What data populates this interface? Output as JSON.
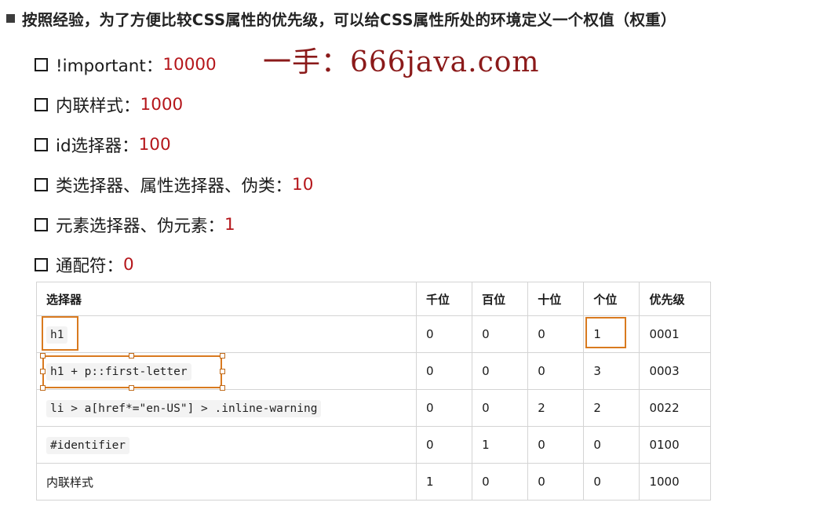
{
  "header": {
    "text": "按照经验，为了方便比较CSS属性的优先级，可以给CSS属性所处的环境定义一个权值（权重）"
  },
  "watermark": "一手：666java.com",
  "rules": [
    {
      "label": "!important：",
      "value": "10000"
    },
    {
      "label": "内联样式：",
      "value": "1000"
    },
    {
      "label": "id选择器：",
      "value": "100"
    },
    {
      "label": "类选择器、属性选择器、伪类：",
      "value": "10"
    },
    {
      "label": "元素选择器、伪元素：",
      "value": "1"
    },
    {
      "label": "通配符：",
      "value": "0"
    }
  ],
  "table": {
    "headers": [
      "选择器",
      "千位",
      "百位",
      "十位",
      "个位",
      "优先级"
    ],
    "rows": [
      {
        "selector": "h1",
        "code": true,
        "thousands": "0",
        "hundreds": "0",
        "tens": "0",
        "ones": "1",
        "specificity": "0001"
      },
      {
        "selector": "h1 + p::first-letter",
        "code": true,
        "thousands": "0",
        "hundreds": "0",
        "tens": "0",
        "ones": "3",
        "specificity": "0003"
      },
      {
        "selector": "li > a[href*=\"en-US\"] > .inline-warning",
        "code": true,
        "thousands": "0",
        "hundreds": "0",
        "tens": "2",
        "ones": "2",
        "specificity": "0022"
      },
      {
        "selector": "#identifier",
        "code": true,
        "thousands": "0",
        "hundreds": "1",
        "tens": "0",
        "ones": "0",
        "specificity": "0100"
      },
      {
        "selector": "内联样式",
        "code": false,
        "thousands": "1",
        "hundreds": "0",
        "tens": "0",
        "ones": "0",
        "specificity": "1000"
      }
    ]
  },
  "colors": {
    "value": "#b5161b",
    "highlight": "#d97a1f",
    "watermark": "#8b1a1a"
  }
}
